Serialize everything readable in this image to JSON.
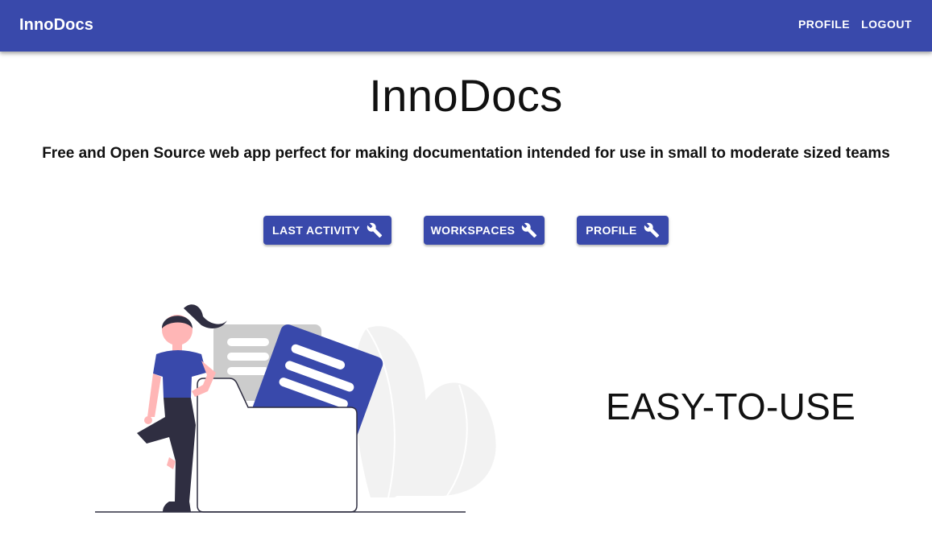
{
  "appbar": {
    "brand": "InnoDocs",
    "nav": [
      {
        "label": "PROFILE"
      },
      {
        "label": "LOGOUT"
      }
    ]
  },
  "hero": {
    "title": "InnoDocs",
    "subtitle": "Free and Open Source web app perfect for making documentation intended for use in small to moderate sized teams"
  },
  "actions": [
    {
      "label": "LAST ACTIVITY",
      "icon": "wrench-icon"
    },
    {
      "label": "WORKSPACES",
      "icon": "wrench-icon"
    },
    {
      "label": "PROFILE",
      "icon": "wrench-icon"
    }
  ],
  "feature": {
    "heading": "EASY-TO-USE"
  },
  "colors": {
    "primary": "#3949ab",
    "skin": "#ffb6b6",
    "hair": "#2f2e41",
    "leaf": "#f2f2f2"
  }
}
